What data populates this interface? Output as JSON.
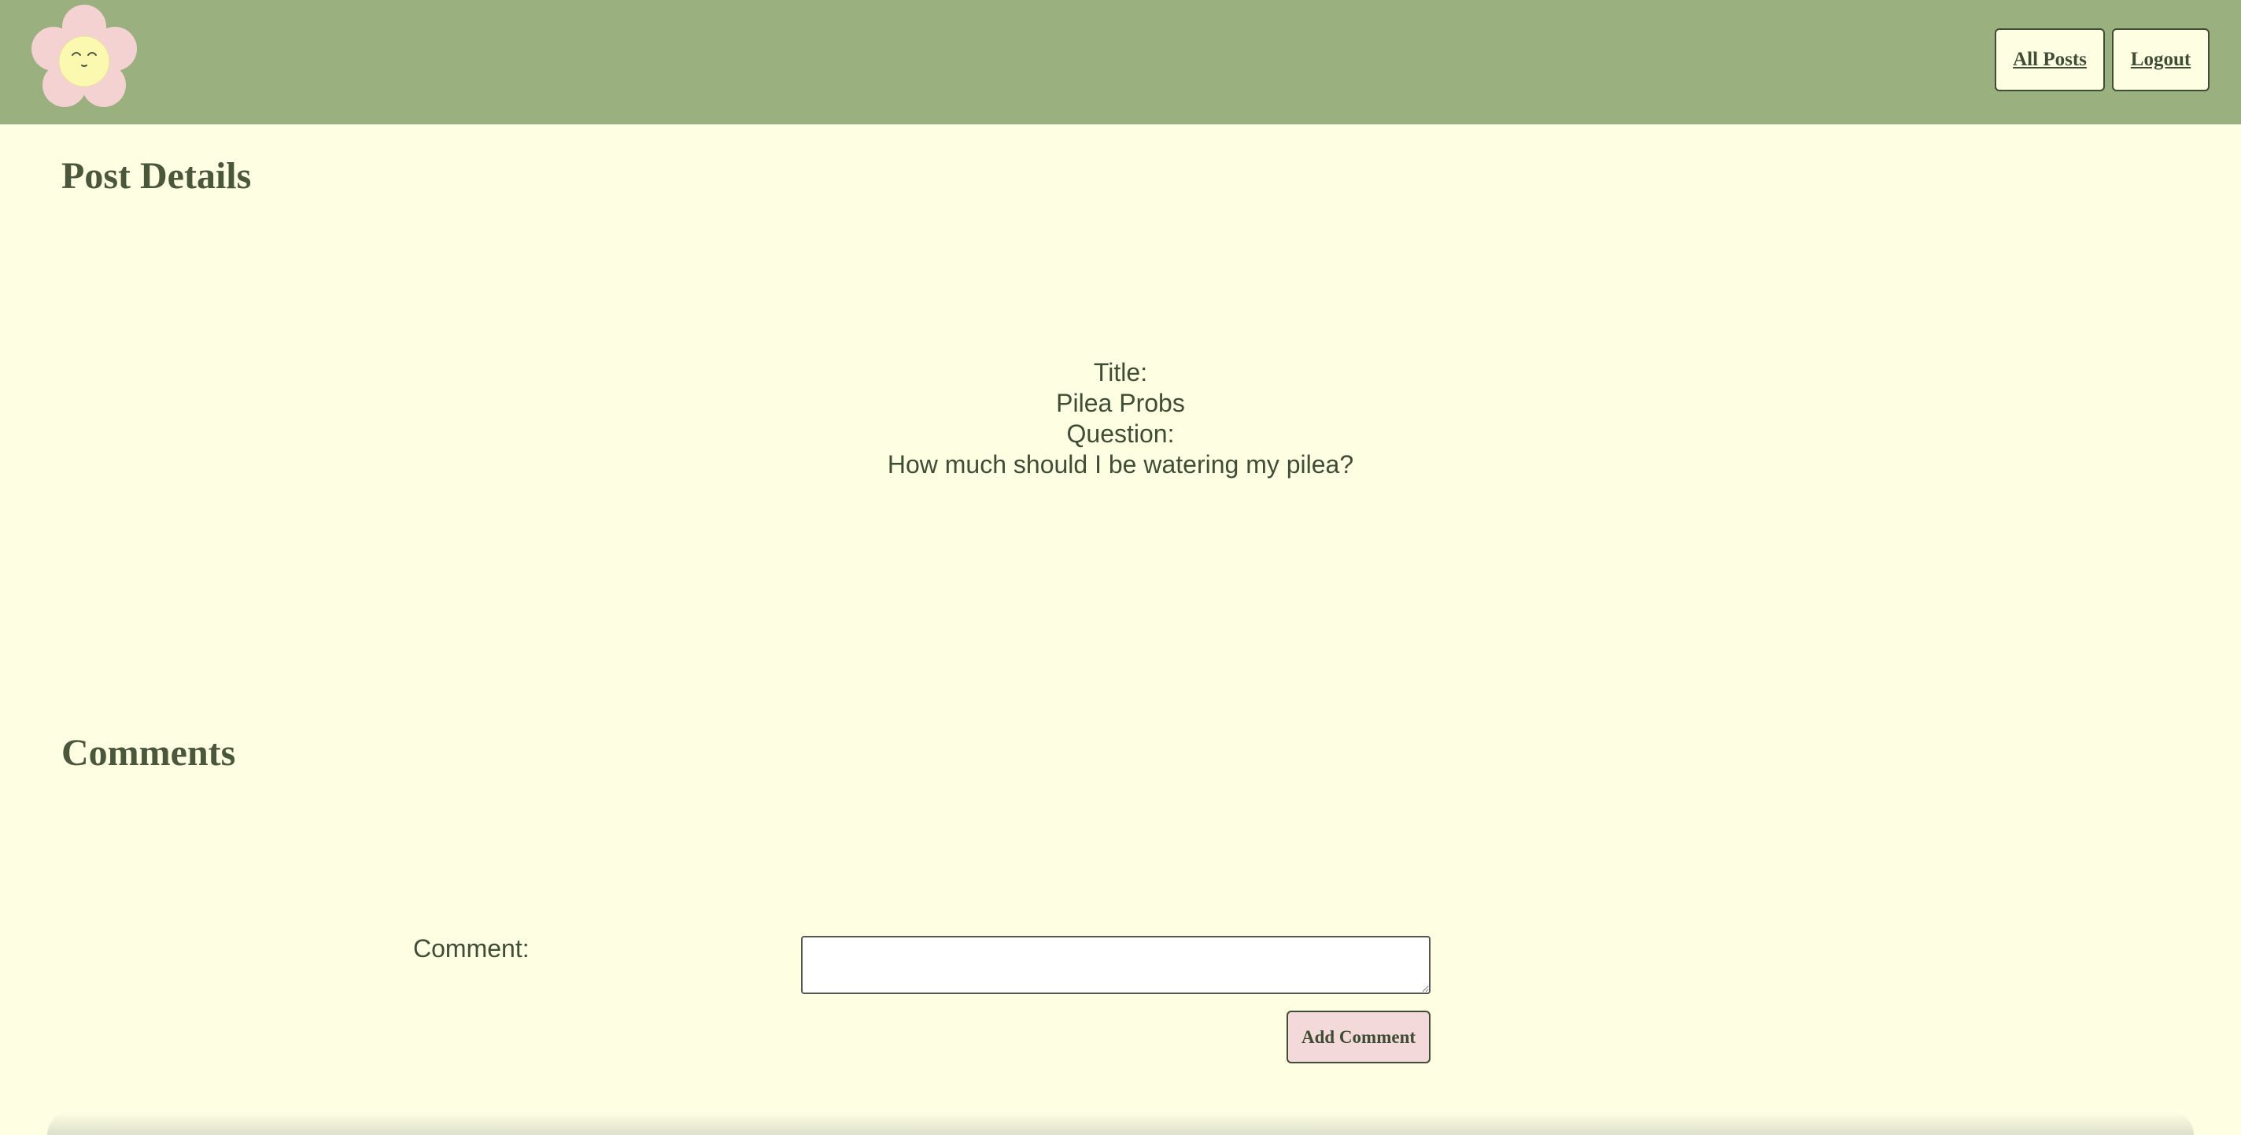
{
  "nav": {
    "all_posts": "All Posts",
    "logout": "Logout",
    "logo": "flower-logo"
  },
  "post": {
    "heading": "Post Details",
    "title_label": "Title:",
    "title_value": "Pilea Probs",
    "question_label": "Question:",
    "question_value": "How much should I be watering my pilea?"
  },
  "comments": {
    "heading": "Comments",
    "comment_label": "Comment:",
    "comment_value": "",
    "add_button": "Add Comment"
  },
  "colors": {
    "navbar": "#9ab07e",
    "background": "#fefee3",
    "text": "#3e4d33",
    "add_button": "#f3d9d9"
  }
}
